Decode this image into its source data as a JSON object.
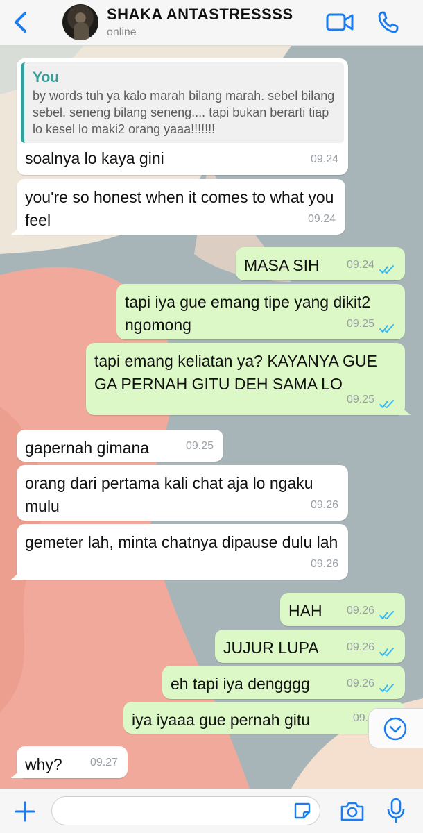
{
  "header": {
    "contact_name": "SHAKA ANTASTRESSSS",
    "status": "online",
    "icons": {
      "back": "chevron-left-icon",
      "video": "video-camera-icon",
      "phone": "phone-icon"
    }
  },
  "messages": [
    {
      "direction": "in",
      "quote": {
        "author": "You",
        "text": "by words tuh ya kalo marah bilang marah. sebel bilang sebel. seneng bilang seneng.... tapi bukan berarti tiap lo kesel lo maki2 orang yaaa!!!!!!!"
      },
      "text": "soalnya lo kaya gini",
      "time": "09.24"
    },
    {
      "direction": "in",
      "text": "you're so honest when it comes to what you feel",
      "time": "09.24"
    },
    {
      "direction": "out",
      "text": "MASA SIH",
      "time": "09.24",
      "status": "read"
    },
    {
      "direction": "out",
      "text": "tapi iya gue emang tipe yang dikit2 ngomong",
      "time": "09.25",
      "status": "read"
    },
    {
      "direction": "out",
      "text": "tapi emang keliatan ya? KAYANYA GUE GA PERNAH GITU DEH SAMA LO",
      "time": "09.25",
      "status": "read"
    },
    {
      "direction": "in",
      "text": "gapernah gimana",
      "time": "09.25"
    },
    {
      "direction": "in",
      "text": "orang dari pertama kali chat aja lo ngaku mulu",
      "time": "09.26"
    },
    {
      "direction": "in",
      "text": "gemeter lah, minta chatnya dipause dulu lah",
      "time": "09.26"
    },
    {
      "direction": "out",
      "text": "HAH",
      "time": "09.26",
      "status": "read"
    },
    {
      "direction": "out",
      "text": "JUJUR LUPA",
      "time": "09.26",
      "status": "read"
    },
    {
      "direction": "out",
      "text": "eh tapi iya dengggg",
      "time": "09.26",
      "status": "read"
    },
    {
      "direction": "out",
      "text": "iya iyaaa gue pernah gitu",
      "time": "09.2",
      "status": "read"
    },
    {
      "direction": "in",
      "text": "why?",
      "time": "09.27"
    }
  ],
  "input_bar": {
    "placeholder": "",
    "icons": {
      "plus": "plus-icon",
      "sticker": "sticker-icon",
      "camera": "camera-icon",
      "mic": "microphone-icon"
    }
  },
  "scroll_down_icon": "chevron-down-circle-icon",
  "colors": {
    "accent": "#1a7cf0",
    "outgoing_bubble": "#dcf8c6",
    "incoming_bubble": "#ffffff",
    "quote_bar": "#35a09a",
    "read_ticks": "#34b7f1"
  }
}
